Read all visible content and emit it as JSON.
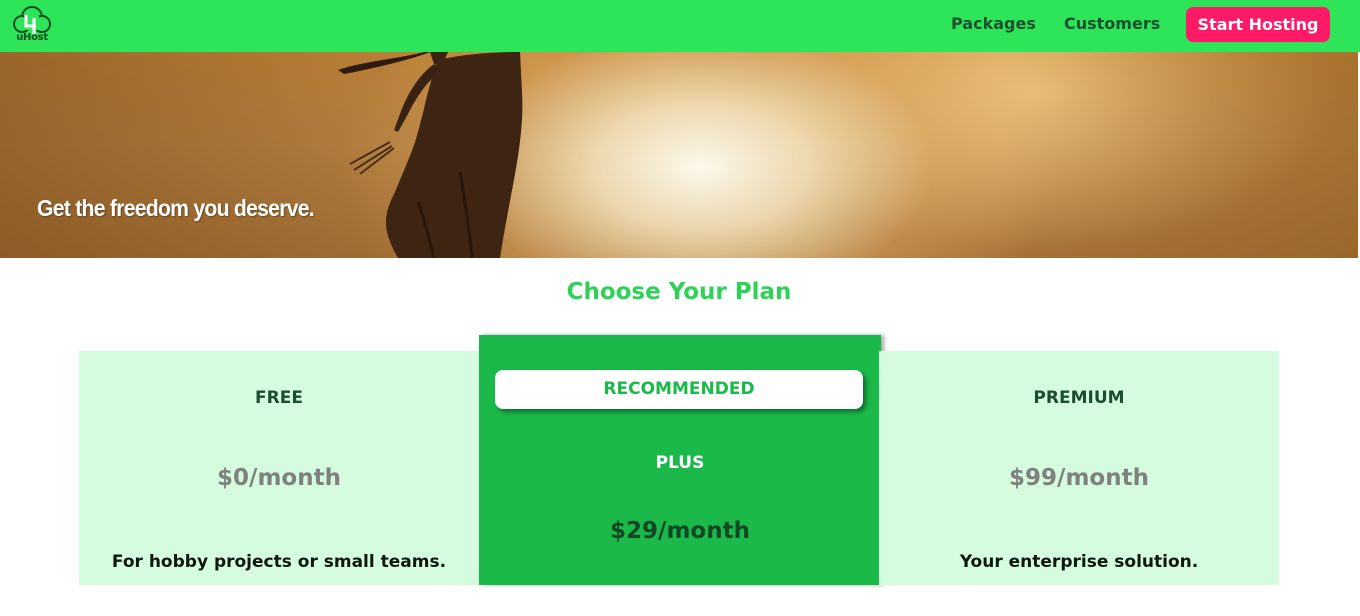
{
  "brand": {
    "logo_text": "uHost",
    "logo_icon": "tree-icon",
    "primary_color": "#2ee55a",
    "accent_color": "#ff1a67"
  },
  "nav": {
    "packages": "Packages",
    "customers": "Customers",
    "cta": "Start Hosting"
  },
  "hero": {
    "tagline": "Get the freedom you deserve."
  },
  "plans_section": {
    "title": "Choose Your Plan",
    "plans": [
      {
        "name": "FREE",
        "price": "$0/month",
        "description": "For hobby projects or small teams."
      },
      {
        "badge": "RECOMMENDED",
        "name": "PLUS",
        "price": "$29/month"
      },
      {
        "name": "PREMIUM",
        "price": "$99/month",
        "description": "Your enterprise solution."
      }
    ]
  }
}
